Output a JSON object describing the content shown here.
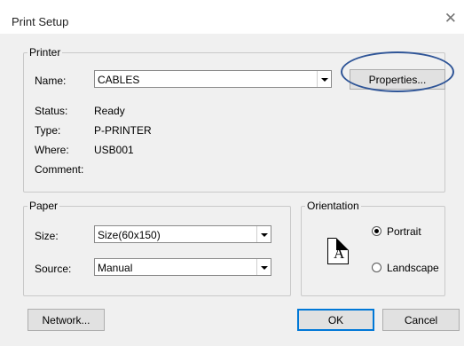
{
  "window": {
    "title": "Print Setup",
    "close_glyph": "✕"
  },
  "printer": {
    "group_label": "Printer",
    "name_label": "Name:",
    "name_value": "CABLES",
    "properties_label": "Properties...",
    "status_label": "Status:",
    "status_value": "Ready",
    "type_label": "Type:",
    "type_value": "P-PRINTER",
    "where_label": "Where:",
    "where_value": "USB001",
    "comment_label": "Comment:",
    "comment_value": ""
  },
  "paper": {
    "group_label": "Paper",
    "size_label": "Size:",
    "size_value": "Size(60x150)",
    "source_label": "Source:",
    "source_value": "Manual"
  },
  "orientation": {
    "group_label": "Orientation",
    "icon_letter": "A",
    "portrait_label": "Portrait",
    "landscape_label": "Landscape",
    "selected": "Portrait"
  },
  "buttons": {
    "network": "Network...",
    "ok": "OK",
    "cancel": "Cancel"
  },
  "colors": {
    "highlight_circle": "#2f5597",
    "default_button_border": "#0078d7"
  }
}
